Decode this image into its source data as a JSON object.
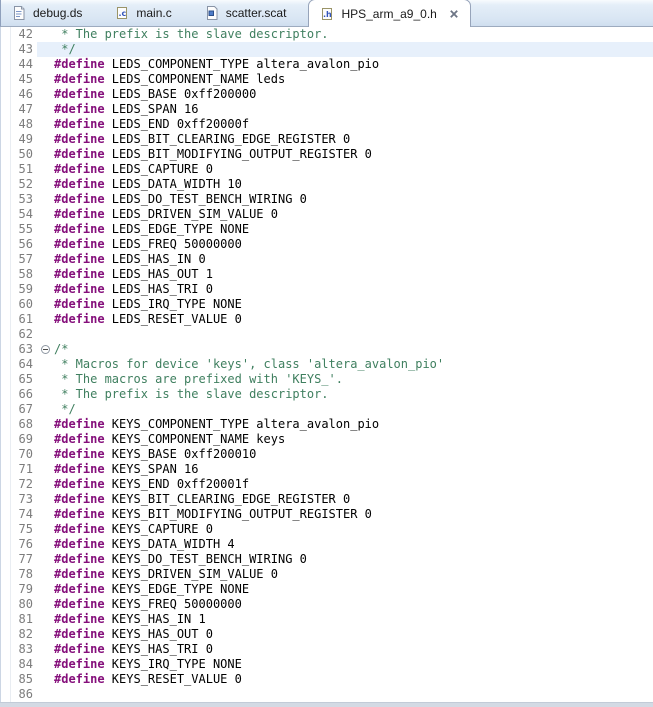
{
  "tabs": [
    {
      "label": "debug.ds",
      "icon": "text-file-icon",
      "active": false
    },
    {
      "label": "main.c",
      "icon": "c-file-icon",
      "active": false
    },
    {
      "label": "scatter.scat",
      "icon": "scatter-file-icon",
      "active": false
    },
    {
      "label": "HPS_arm_a9_0.h",
      "icon": "h-file-icon",
      "active": true
    }
  ],
  "icons": {
    "tab_close": "x-cross",
    "fold_collapsed_region": "circled-minus"
  },
  "colors": {
    "keyword": "#850f7b",
    "comment": "#3f7f5f",
    "plain_code": "#000000",
    "line_number": "#7d7d7d",
    "current_line_highlight": "#e7f0fb",
    "tabbar_gradient_top": "#f8fbfe",
    "tabbar_gradient_bottom": "#cfdeef",
    "tabbar_border": "#9dabbf"
  },
  "editor": {
    "current_line": 43,
    "lines": [
      {
        "num": 42,
        "kind": "comment",
        "text": " * The prefix is the slave descriptor."
      },
      {
        "num": 43,
        "kind": "comment",
        "text": " */"
      },
      {
        "num": 44,
        "kind": "directive",
        "keyword": "#define",
        "code": "LEDS_COMPONENT_TYPE altera_avalon_pio"
      },
      {
        "num": 45,
        "kind": "directive",
        "keyword": "#define",
        "code": "LEDS_COMPONENT_NAME leds"
      },
      {
        "num": 46,
        "kind": "directive",
        "keyword": "#define",
        "code": "LEDS_BASE 0xff200000"
      },
      {
        "num": 47,
        "kind": "directive",
        "keyword": "#define",
        "code": "LEDS_SPAN 16"
      },
      {
        "num": 48,
        "kind": "directive",
        "keyword": "#define",
        "code": "LEDS_END 0xff20000f"
      },
      {
        "num": 49,
        "kind": "directive",
        "keyword": "#define",
        "code": "LEDS_BIT_CLEARING_EDGE_REGISTER 0"
      },
      {
        "num": 50,
        "kind": "directive",
        "keyword": "#define",
        "code": "LEDS_BIT_MODIFYING_OUTPUT_REGISTER 0"
      },
      {
        "num": 51,
        "kind": "directive",
        "keyword": "#define",
        "code": "LEDS_CAPTURE 0"
      },
      {
        "num": 52,
        "kind": "directive",
        "keyword": "#define",
        "code": "LEDS_DATA_WIDTH 10"
      },
      {
        "num": 53,
        "kind": "directive",
        "keyword": "#define",
        "code": "LEDS_DO_TEST_BENCH_WIRING 0"
      },
      {
        "num": 54,
        "kind": "directive",
        "keyword": "#define",
        "code": "LEDS_DRIVEN_SIM_VALUE 0"
      },
      {
        "num": 55,
        "kind": "directive",
        "keyword": "#define",
        "code": "LEDS_EDGE_TYPE NONE"
      },
      {
        "num": 56,
        "kind": "directive",
        "keyword": "#define",
        "code": "LEDS_FREQ 50000000"
      },
      {
        "num": 57,
        "kind": "directive",
        "keyword": "#define",
        "code": "LEDS_HAS_IN 0"
      },
      {
        "num": 58,
        "kind": "directive",
        "keyword": "#define",
        "code": "LEDS_HAS_OUT 1"
      },
      {
        "num": 59,
        "kind": "directive",
        "keyword": "#define",
        "code": "LEDS_HAS_TRI 0"
      },
      {
        "num": 60,
        "kind": "directive",
        "keyword": "#define",
        "code": "LEDS_IRQ_TYPE NONE"
      },
      {
        "num": 61,
        "kind": "directive",
        "keyword": "#define",
        "code": "LEDS_RESET_VALUE 0"
      },
      {
        "num": 62,
        "kind": "blank"
      },
      {
        "num": 63,
        "kind": "comment",
        "text": "/*",
        "fold": true
      },
      {
        "num": 64,
        "kind": "comment",
        "text": " * Macros for device 'keys', class 'altera_avalon_pio'"
      },
      {
        "num": 65,
        "kind": "comment",
        "text": " * The macros are prefixed with 'KEYS_'."
      },
      {
        "num": 66,
        "kind": "comment",
        "text": " * The prefix is the slave descriptor."
      },
      {
        "num": 67,
        "kind": "comment",
        "text": " */"
      },
      {
        "num": 68,
        "kind": "directive",
        "keyword": "#define",
        "code": "KEYS_COMPONENT_TYPE altera_avalon_pio"
      },
      {
        "num": 69,
        "kind": "directive",
        "keyword": "#define",
        "code": "KEYS_COMPONENT_NAME keys"
      },
      {
        "num": 70,
        "kind": "directive",
        "keyword": "#define",
        "code": "KEYS_BASE 0xff200010"
      },
      {
        "num": 71,
        "kind": "directive",
        "keyword": "#define",
        "code": "KEYS_SPAN 16"
      },
      {
        "num": 72,
        "kind": "directive",
        "keyword": "#define",
        "code": "KEYS_END 0xff20001f"
      },
      {
        "num": 73,
        "kind": "directive",
        "keyword": "#define",
        "code": "KEYS_BIT_CLEARING_EDGE_REGISTER 0"
      },
      {
        "num": 74,
        "kind": "directive",
        "keyword": "#define",
        "code": "KEYS_BIT_MODIFYING_OUTPUT_REGISTER 0"
      },
      {
        "num": 75,
        "kind": "directive",
        "keyword": "#define",
        "code": "KEYS_CAPTURE 0"
      },
      {
        "num": 76,
        "kind": "directive",
        "keyword": "#define",
        "code": "KEYS_DATA_WIDTH 4"
      },
      {
        "num": 77,
        "kind": "directive",
        "keyword": "#define",
        "code": "KEYS_DO_TEST_BENCH_WIRING 0"
      },
      {
        "num": 78,
        "kind": "directive",
        "keyword": "#define",
        "code": "KEYS_DRIVEN_SIM_VALUE 0"
      },
      {
        "num": 79,
        "kind": "directive",
        "keyword": "#define",
        "code": "KEYS_EDGE_TYPE NONE"
      },
      {
        "num": 80,
        "kind": "directive",
        "keyword": "#define",
        "code": "KEYS_FREQ 50000000"
      },
      {
        "num": 81,
        "kind": "directive",
        "keyword": "#define",
        "code": "KEYS_HAS_IN 1"
      },
      {
        "num": 82,
        "kind": "directive",
        "keyword": "#define",
        "code": "KEYS_HAS_OUT 0"
      },
      {
        "num": 83,
        "kind": "directive",
        "keyword": "#define",
        "code": "KEYS_HAS_TRI 0"
      },
      {
        "num": 84,
        "kind": "directive",
        "keyword": "#define",
        "code": "KEYS_IRQ_TYPE NONE"
      },
      {
        "num": 85,
        "kind": "directive",
        "keyword": "#define",
        "code": "KEYS_RESET_VALUE 0"
      },
      {
        "num": 86,
        "kind": "blank"
      }
    ]
  }
}
